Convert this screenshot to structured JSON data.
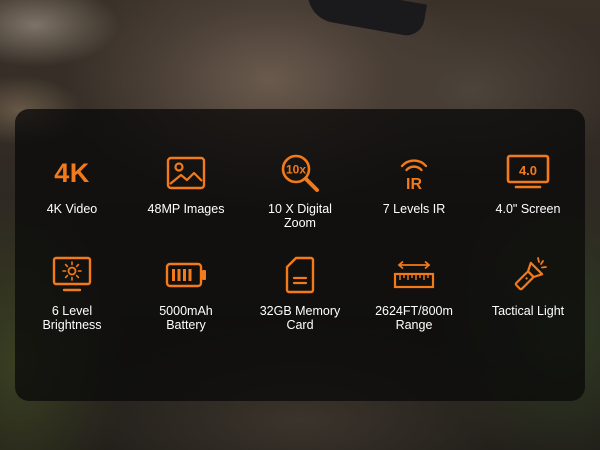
{
  "colors": {
    "accent": "#f27a1a",
    "panel": "rgba(10,10,10,0.78)",
    "text": "#ffffff"
  },
  "features": [
    {
      "icon": "4k-text-icon",
      "icon_text": "4K",
      "label_lines": [
        "4K Video"
      ]
    },
    {
      "icon": "image-icon",
      "label_lines": [
        "48MP Images"
      ]
    },
    {
      "icon": "zoom-magnifier-icon",
      "icon_text": "10x",
      "label_lines": [
        "10 X Digital",
        "Zoom"
      ]
    },
    {
      "icon": "infrared-icon",
      "icon_text": "IR",
      "label_lines": [
        "7 Levels IR"
      ]
    },
    {
      "icon": "screen-icon",
      "icon_text": "4.0",
      "label_lines": [
        "4.0\" Screen"
      ]
    },
    {
      "icon": "brightness-icon",
      "label_lines": [
        "6 Level",
        "Brightness"
      ]
    },
    {
      "icon": "battery-icon",
      "label_lines": [
        "5000mAh",
        "Battery"
      ]
    },
    {
      "icon": "memory-card-icon",
      "label_lines": [
        "32GB Memory",
        "Card"
      ]
    },
    {
      "icon": "range-ruler-icon",
      "label_lines": [
        "2624FT/800m",
        "Range"
      ]
    },
    {
      "icon": "flashlight-icon",
      "label_lines": [
        "Tactical Light"
      ]
    }
  ]
}
